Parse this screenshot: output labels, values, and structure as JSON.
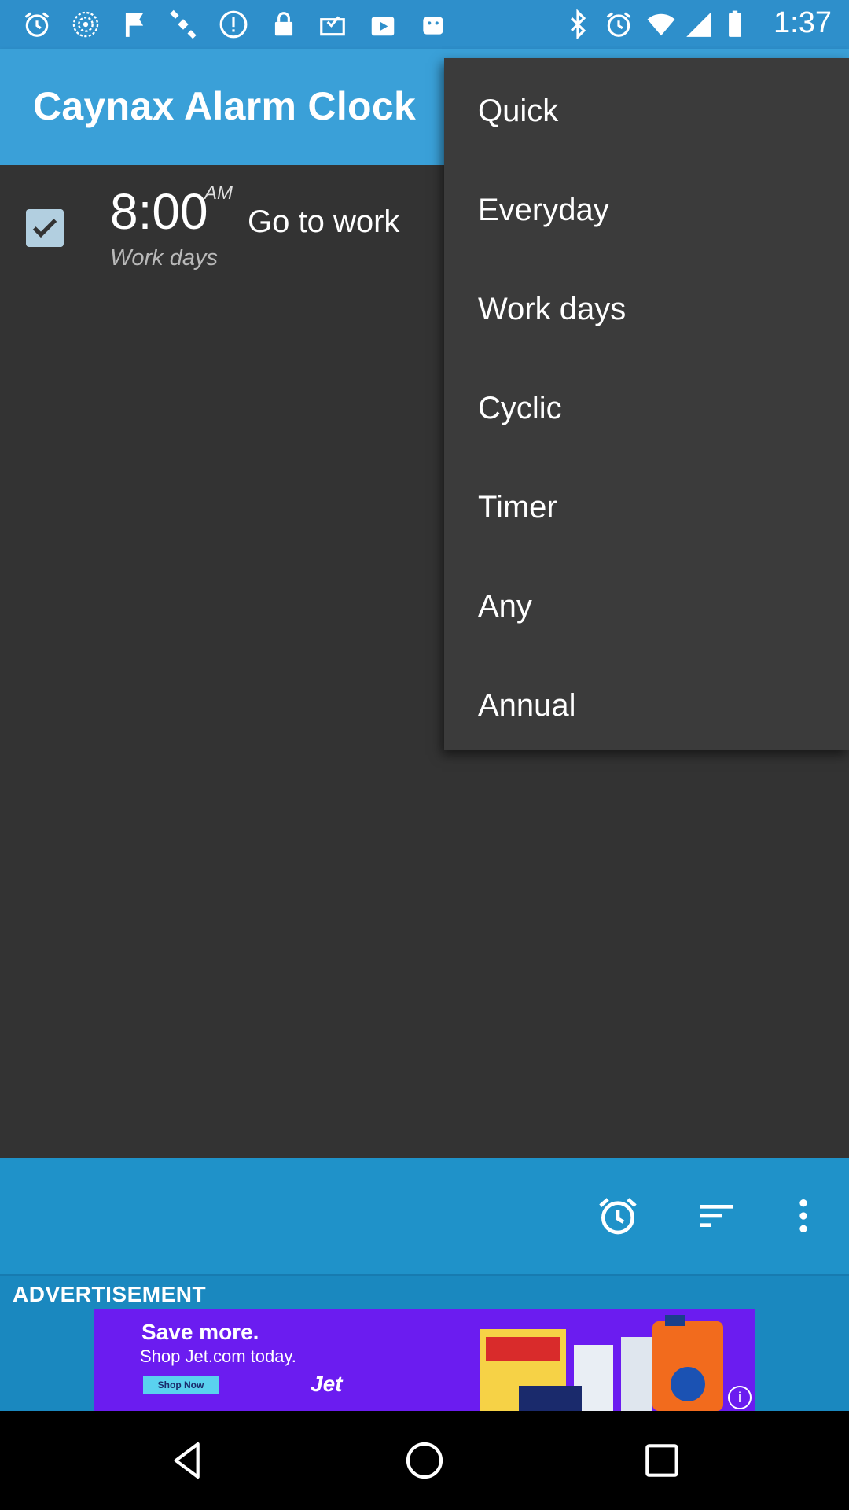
{
  "status_bar": {
    "time": "1:37",
    "left_icons": [
      "alarm-icon",
      "radio-signal-icon",
      "fake-gps-icon",
      "satellite-icon",
      "info-circle-icon",
      "lock-icon",
      "mail-check-icon",
      "play-store-icon",
      "android-icon"
    ],
    "right_icons": [
      "bluetooth-icon",
      "alarm-icon"
    ]
  },
  "app_bar": {
    "title": "Caynax Alarm Clock"
  },
  "alarm": {
    "checked": true,
    "time": "8:00",
    "ampm": "AM",
    "name": "Go to work",
    "repeat": "Work days"
  },
  "menu": {
    "items": [
      {
        "label": "Quick"
      },
      {
        "label": "Everyday"
      },
      {
        "label": "Work days"
      },
      {
        "label": "Cyclic"
      },
      {
        "label": "Timer"
      },
      {
        "label": "Any"
      },
      {
        "label": "Annual"
      }
    ]
  },
  "bottom_bar": {
    "icons": [
      "add-alarm-icon",
      "sort-icon",
      "more-vert-icon"
    ]
  },
  "ad": {
    "label": "ADVERTISEMENT",
    "headline": "Save more.",
    "subline": "Shop Jet.com today.",
    "cta": "Shop Now",
    "brand": "Jet",
    "colors": {
      "background": "#6b1cf0",
      "cta": "#5ad1ef"
    }
  },
  "nav_bar": {
    "icons": [
      "back-icon",
      "home-icon",
      "recents-icon"
    ]
  },
  "colors": {
    "status_bar": "#2e8fcb",
    "app_bar": "#3aa0d8",
    "content_bg": "#333333",
    "menu_bg": "#3b3b3b",
    "bottom_bar": "#1f92c9"
  }
}
